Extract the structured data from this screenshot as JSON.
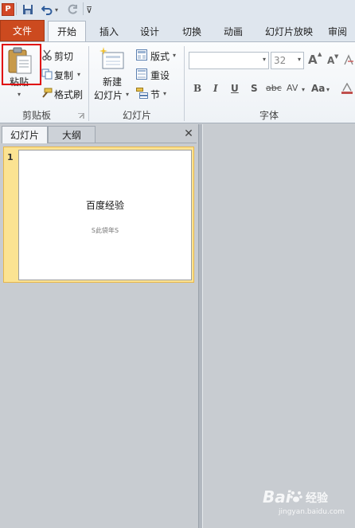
{
  "quick_access": {
    "app_icon_letter": "P",
    "undo_dropdown": "▾",
    "customize": "⊽"
  },
  "tabs": [
    {
      "label": "文件"
    },
    {
      "label": "开始"
    },
    {
      "label": "插入"
    },
    {
      "label": "设计"
    },
    {
      "label": "切换"
    },
    {
      "label": "动画"
    },
    {
      "label": "幻灯片放映"
    },
    {
      "label": "审阅"
    }
  ],
  "ribbon": {
    "clipboard": {
      "paste_label": "粘贴",
      "cut_label": "剪切",
      "copy_label": "复制",
      "format_painter_label": "格式刷",
      "group_label": "剪贴板"
    },
    "slides": {
      "new_slide_line1": "新建",
      "new_slide_line2": "幻灯片",
      "layout_label": "版式",
      "reset_label": "重设",
      "section_label": "节",
      "group_label": "幻灯片"
    },
    "font": {
      "font_name_value": "",
      "font_size_value": "32",
      "bold": "B",
      "italic": "I",
      "underline": "U",
      "shadow": "S",
      "strikethrough": "abc",
      "char_spacing": "AV",
      "change_case": "Aa",
      "grow_font": "A",
      "shrink_font": "A",
      "group_label": "字体"
    }
  },
  "pane": {
    "tab_slides": "幻灯片",
    "tab_outline": "大纲",
    "close": "✕"
  },
  "slides": [
    {
      "number": "1",
      "title": "百度经验",
      "subtitle": "S此袋年S"
    }
  ],
  "watermark": {
    "brand_left": "Bai",
    "brand_right": "经验",
    "url": "jingyan.baidu.com"
  },
  "colors": {
    "file_tab": "#cc4a1f",
    "selected_slide": "#fbe392",
    "highlight_box": "#e00000"
  }
}
